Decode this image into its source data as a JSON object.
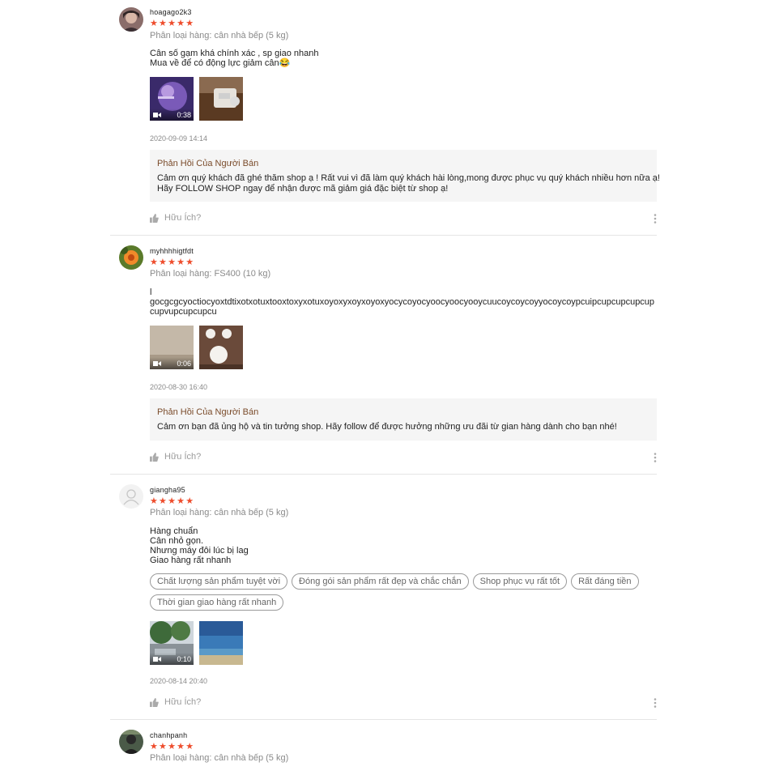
{
  "reviews": [
    {
      "username": "hoagago2k3",
      "stars": "★★★★★",
      "variant": "Phân loại hàng: cân nhà bếp (5 kg)",
      "content": [
        "Cân số gạm khá chính xác , sp giao nhanh",
        "Mua về để có động lực giảm cân😂"
      ],
      "media": [
        {
          "type": "video",
          "duration": "0:38"
        },
        {
          "type": "image"
        }
      ],
      "time": "2020-09-09 14:14",
      "reply": {
        "title": "Phản Hồi Của Người Bán",
        "lines": [
          "Cảm ơn quý khách đã ghé thăm shop ạ ! Rất vui vì đã làm quý khách hài lòng,mong được phục vụ quý khách nhiều hơn nữa ạ!",
          "Hãy FOLLOW SHOP ngay để nhận được mã giảm giá đặc biệt từ shop ạ!"
        ]
      },
      "helpful": "Hữu Ích?"
    },
    {
      "username": "myhhhhigtfdt",
      "stars": "★★★★★",
      "variant": "Phân loại hàng: FS400 (10 kg)",
      "content": [
        "l",
        "gocgcgcyoctiocyoxtdtixotxotuxtooxtoxyxotuxoyoxyxoyxoyoxyocycoyocyoocyoocyooycuucoycoycoyyocoycoypcuipcupcupcupcupcupvupcupcupcu"
      ],
      "media": [
        {
          "type": "video",
          "duration": "0:06"
        },
        {
          "type": "image"
        }
      ],
      "time": "2020-08-30 16:40",
      "reply": {
        "title": "Phản Hồi Của Người Bán",
        "lines": [
          "Cảm ơn bạn đã ủng hộ và tin tưởng shop. Hãy follow để được hưởng những ưu đãi từ gian hàng dành cho bạn nhé!"
        ]
      },
      "helpful": "Hữu Ích?"
    },
    {
      "username": "giangha95",
      "stars": "★★★★★",
      "variant": "Phân loại hàng: cân nhà bếp (5 kg)",
      "content": [
        "Hàng chuẩn",
        "Cân nhỏ gọn.",
        "Nhưng máy đôi lúc bị lag",
        "Giao hàng rất nhanh"
      ],
      "tags": [
        "Chất lượng sản phẩm tuyệt vời",
        "Đóng gói sản phẩm rất đẹp và chắc chắn",
        "Shop phục vụ rất tốt",
        "Rất đáng tiền",
        "Thời gian giao hàng rất nhanh"
      ],
      "media": [
        {
          "type": "video",
          "duration": "0:10"
        },
        {
          "type": "image"
        }
      ],
      "time": "2020-08-14 20:40",
      "helpful": "Hữu Ích?"
    },
    {
      "username": "chanhpanh",
      "stars": "★★★★★",
      "variant": "Phân loại hàng: cân nhà bếp (5 kg)"
    }
  ],
  "colors": {
    "star": "#ee4d2d",
    "reply_title": "#7a4b2a",
    "meta": "#8a8a8a",
    "reply_bg": "#f5f5f5"
  },
  "icons": {
    "like": "thumbs-up-icon",
    "more": "more-vertical-icon",
    "video": "video-camera-icon"
  }
}
